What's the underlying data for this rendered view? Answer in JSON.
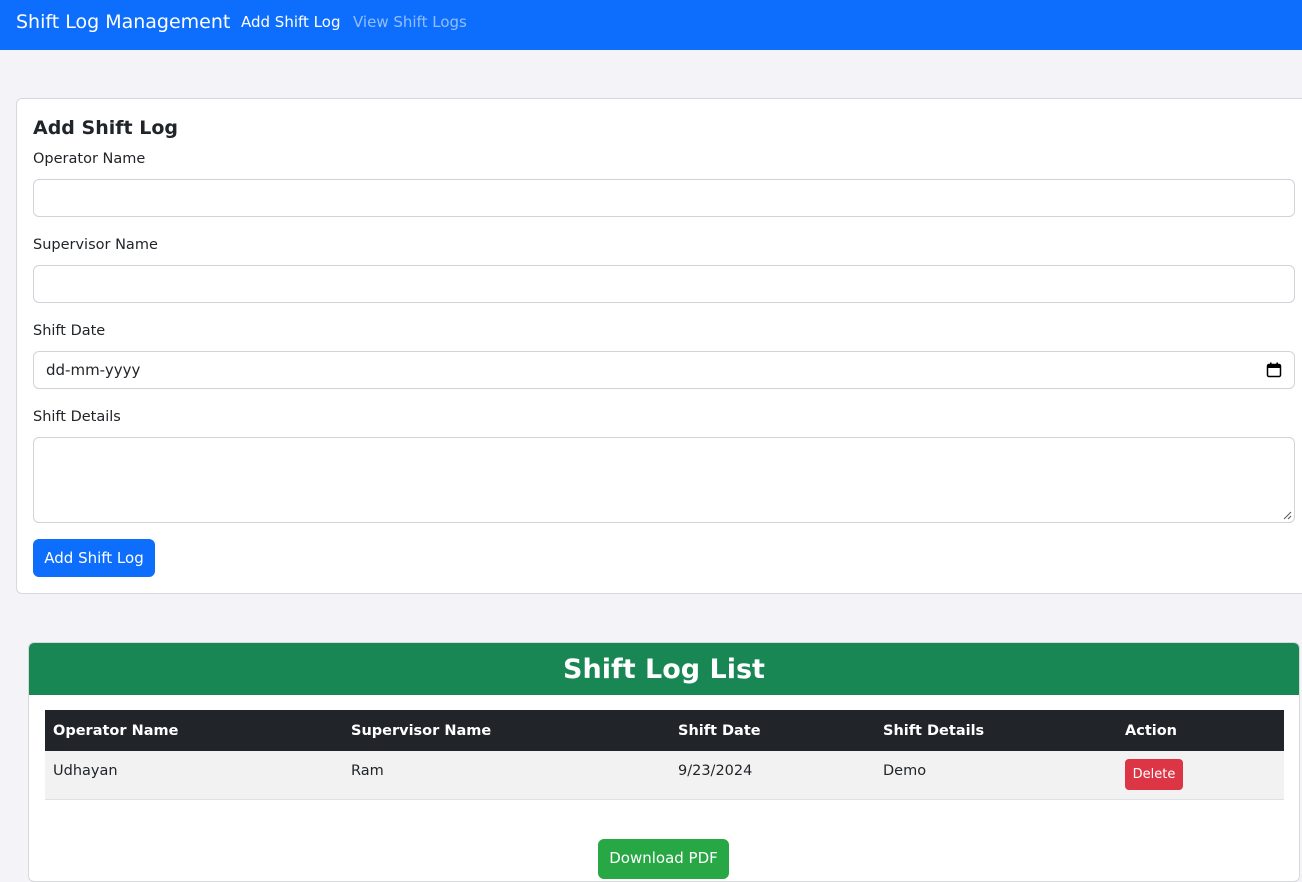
{
  "navbar": {
    "brand": "Shift Log Management",
    "links": [
      {
        "label": "Add Shift Log",
        "active": true
      },
      {
        "label": "View Shift Logs",
        "active": false
      }
    ],
    "color": "#0d6efd"
  },
  "form": {
    "title": "Add Shift Log",
    "operator_label": "Operator Name",
    "operator_value": "",
    "supervisor_label": "Supervisor Name",
    "supervisor_value": "",
    "date_label": "Shift Date",
    "date_placeholder": "dd-mm-yyyy",
    "details_label": "Shift Details",
    "details_value": "",
    "submit_label": "Add Shift Log",
    "calendar_icon": "calendar-icon"
  },
  "list": {
    "title": "Shift Log List",
    "header_color": "#198754",
    "columns": [
      "Operator Name",
      "Supervisor Name",
      "Shift Date",
      "Shift Details",
      "Action"
    ],
    "rows": [
      {
        "operator": "Udhayan",
        "supervisor": "Ram",
        "date": "9/23/2024",
        "details": "Demo",
        "action": "Delete"
      }
    ],
    "download_label": "Download PDF"
  }
}
